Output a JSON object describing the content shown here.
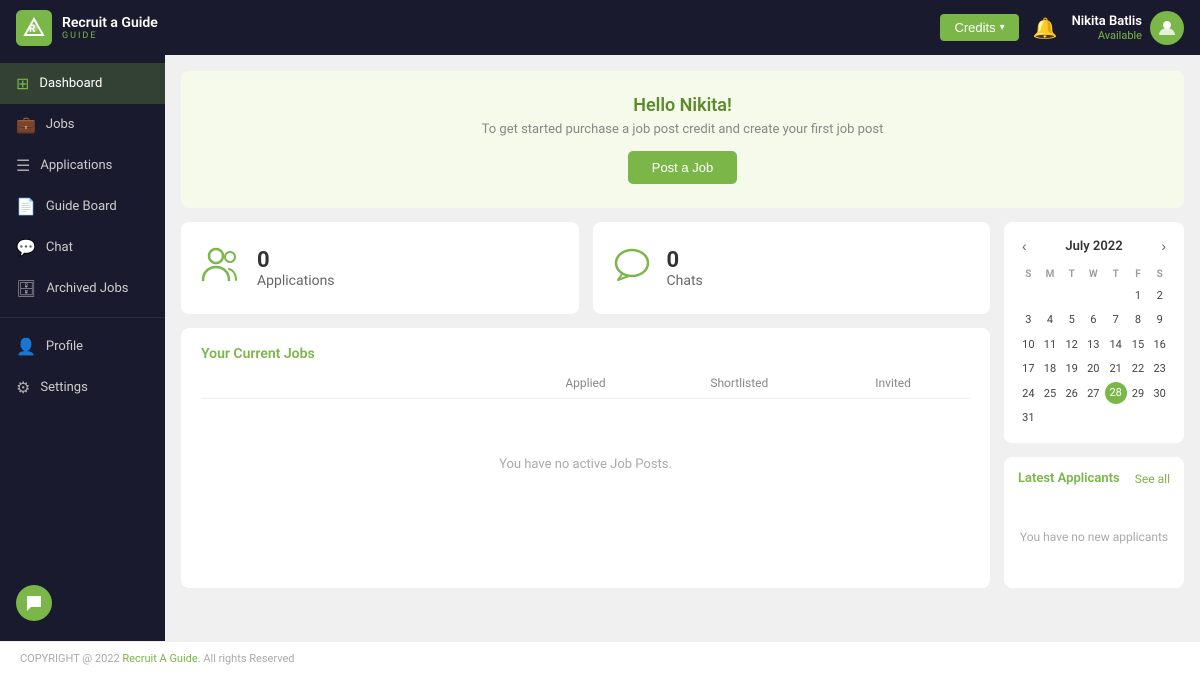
{
  "topbar": {
    "logo_text": "Recruit a Guide",
    "logo_sub": "GUIDE",
    "credits_label": "Credits",
    "bell_symbol": "🔔",
    "user": {
      "name": "Nikita Batlis",
      "status": "Available"
    }
  },
  "sidebar": {
    "items": [
      {
        "id": "dashboard",
        "label": "Dashboard",
        "icon": "⊞",
        "active": true
      },
      {
        "id": "jobs",
        "label": "Jobs",
        "icon": "💼",
        "active": false
      },
      {
        "id": "applications",
        "label": "Applications",
        "icon": "☰",
        "active": false
      },
      {
        "id": "guide-board",
        "label": "Guide Board",
        "icon": "📄",
        "active": false
      },
      {
        "id": "chat",
        "label": "Chat",
        "icon": "💬",
        "active": false
      },
      {
        "id": "archived-jobs",
        "label": "Archived Jobs",
        "icon": "🗄",
        "active": false
      }
    ],
    "bottom_items": [
      {
        "id": "profile",
        "label": "Profile",
        "icon": "👤"
      },
      {
        "id": "settings",
        "label": "Settings",
        "icon": "⚙"
      }
    ]
  },
  "welcome": {
    "title": "Hello Nikita!",
    "subtitle": "To get started purchase a job post credit and create your first job post",
    "button_label": "Post a Job"
  },
  "stats": [
    {
      "id": "applications",
      "count": "0",
      "label": "Applications"
    },
    {
      "id": "chats",
      "count": "0",
      "label": "Chats"
    }
  ],
  "jobs_table": {
    "title": "Your Current Jobs",
    "columns": [
      "Applied",
      "Shortlisted",
      "Invited"
    ],
    "empty_text": "You have no active Job Posts."
  },
  "calendar": {
    "month": "July 2022",
    "day_labels": [
      "S",
      "M",
      "T",
      "W",
      "T",
      "F",
      "S"
    ],
    "today": 28,
    "weeks": [
      [
        "",
        "",
        "",
        "",
        "",
        "1",
        "2"
      ],
      [
        "3",
        "4",
        "5",
        "6",
        "7",
        "8",
        "9"
      ],
      [
        "10",
        "11",
        "12",
        "13",
        "14",
        "15",
        "16"
      ],
      [
        "17",
        "18",
        "19",
        "20",
        "21",
        "22",
        "23"
      ],
      [
        "24",
        "25",
        "26",
        "27",
        "28",
        "29",
        "30"
      ],
      [
        "31",
        "",
        "",
        "",
        "",
        "",
        ""
      ]
    ]
  },
  "applicants": {
    "title": "Latest Applicants",
    "see_all": "See all",
    "empty_text": "You have no new applicants"
  },
  "footer": {
    "copyright": "COPYRIGHT @ 2022 ",
    "link_text": "Recruit A Guide",
    "suffix": ". All rights Reserved"
  }
}
